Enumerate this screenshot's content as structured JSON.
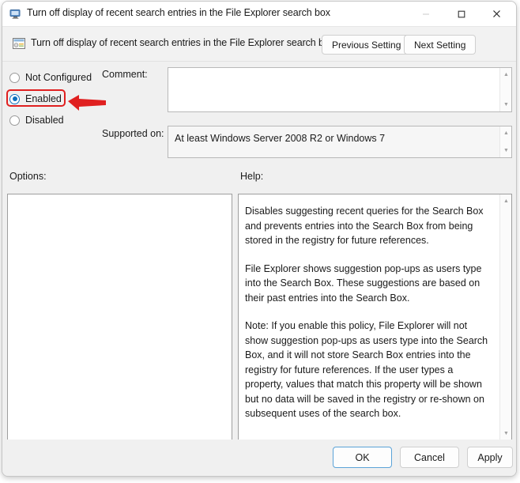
{
  "window": {
    "title": "Turn off display of recent search entries in the File Explorer search box",
    "title_icon": "computer-monitor-icon",
    "minimize_label": "—",
    "maximize_label": "☐",
    "close_label": "✕"
  },
  "header": {
    "policy_icon": "policy-setting-icon",
    "policy_title": "Turn off display of recent search entries in the File Explorer search box",
    "previous_setting_label": "Previous Setting",
    "next_setting_label": "Next Setting"
  },
  "state_options": {
    "not_configured_label": "Not Configured",
    "enabled_label": "Enabled",
    "disabled_label": "Disabled",
    "selected": "Enabled"
  },
  "annotation": {
    "highlight_target": "Enabled",
    "highlight_color": "#e02020",
    "arrow_color": "#e02020",
    "arrow_direction": "left"
  },
  "fields": {
    "comment_label": "Comment:",
    "comment_value": "",
    "supported_label": "Supported on:",
    "supported_value": "At least Windows Server 2008 R2 or Windows 7"
  },
  "panels": {
    "options_label": "Options:",
    "options_content": "",
    "help_label": "Help:",
    "help_paragraphs": [
      "Disables suggesting recent queries for the Search Box and prevents entries into the Search Box from being stored in the registry for future references.",
      "File Explorer shows suggestion pop-ups as users type into the Search Box.  These suggestions are based on their past entries into the Search Box.",
      "Note: If you enable this policy, File Explorer will not show suggestion pop-ups as users type into the Search Box, and it will not store Search Box entries into the registry for future references.  If the user types a property, values that match this property will be shown but no data will be saved in the registry or re-shown on subsequent uses of the search box."
    ]
  },
  "footer": {
    "ok_label": "OK",
    "cancel_label": "Cancel",
    "apply_label": "Apply"
  },
  "scroll_arrows": {
    "up": "▲",
    "down": "▼"
  }
}
